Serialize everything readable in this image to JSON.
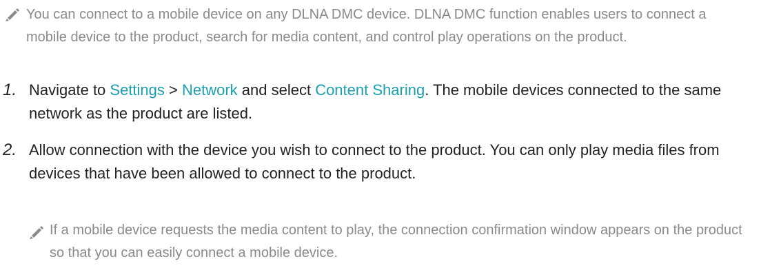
{
  "note_top": {
    "text": "You can connect to a mobile device on any DLNA DMC device. DLNA DMC function enables users to connect a mobile device to the product, search for media content, and control play operations on the product."
  },
  "steps": [
    {
      "number": "1.",
      "prefix": "Navigate to ",
      "link1": "Settings",
      "sep": " > ",
      "link2": "Network",
      "middle": " and select ",
      "link3": "Content Sharing",
      "suffix": ". The mobile devices connected to the same network as the product are listed."
    },
    {
      "number": "2.",
      "text": "Allow connection with the device you wish to connect to the product. You can only play media files from devices that have been allowed to connect to the product."
    }
  ],
  "note_sub": {
    "text": "If a mobile device requests the media content to play, the connection confirmation window appears on the product so that you can easily connect a mobile device."
  },
  "icons": {
    "note_icon": "pencil-icon"
  },
  "colors": {
    "highlight": "#1a9fb0",
    "note_text": "#8a8a8a",
    "body_text": "#222222"
  }
}
